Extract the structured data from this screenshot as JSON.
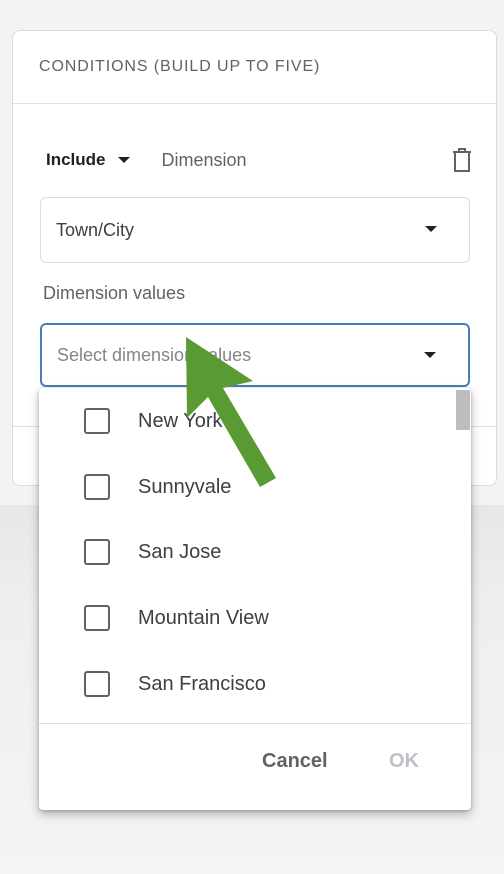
{
  "card": {
    "header": "CONDITIONS (BUILD UP TO FIVE)"
  },
  "condition": {
    "include_label": "Include",
    "dimension_label": "Dimension",
    "dimension_value": "Town/City",
    "values_label": "Dimension values",
    "values_placeholder": "Select dimension values"
  },
  "dropdown": {
    "options": [
      "New York",
      "Sunnyvale",
      "San Jose",
      "Mountain View",
      "San Francisco"
    ],
    "cancel_label": "Cancel",
    "ok_label": "OK"
  },
  "icons": {
    "delete": "trash-icon",
    "dropdown": "caret-down-icon",
    "annotation": "green-arrow-annotation"
  },
  "colors": {
    "focus_border": "#4a7fb5",
    "arrow": "#5a9a32",
    "ok_disabled": "#bdc1c6"
  }
}
